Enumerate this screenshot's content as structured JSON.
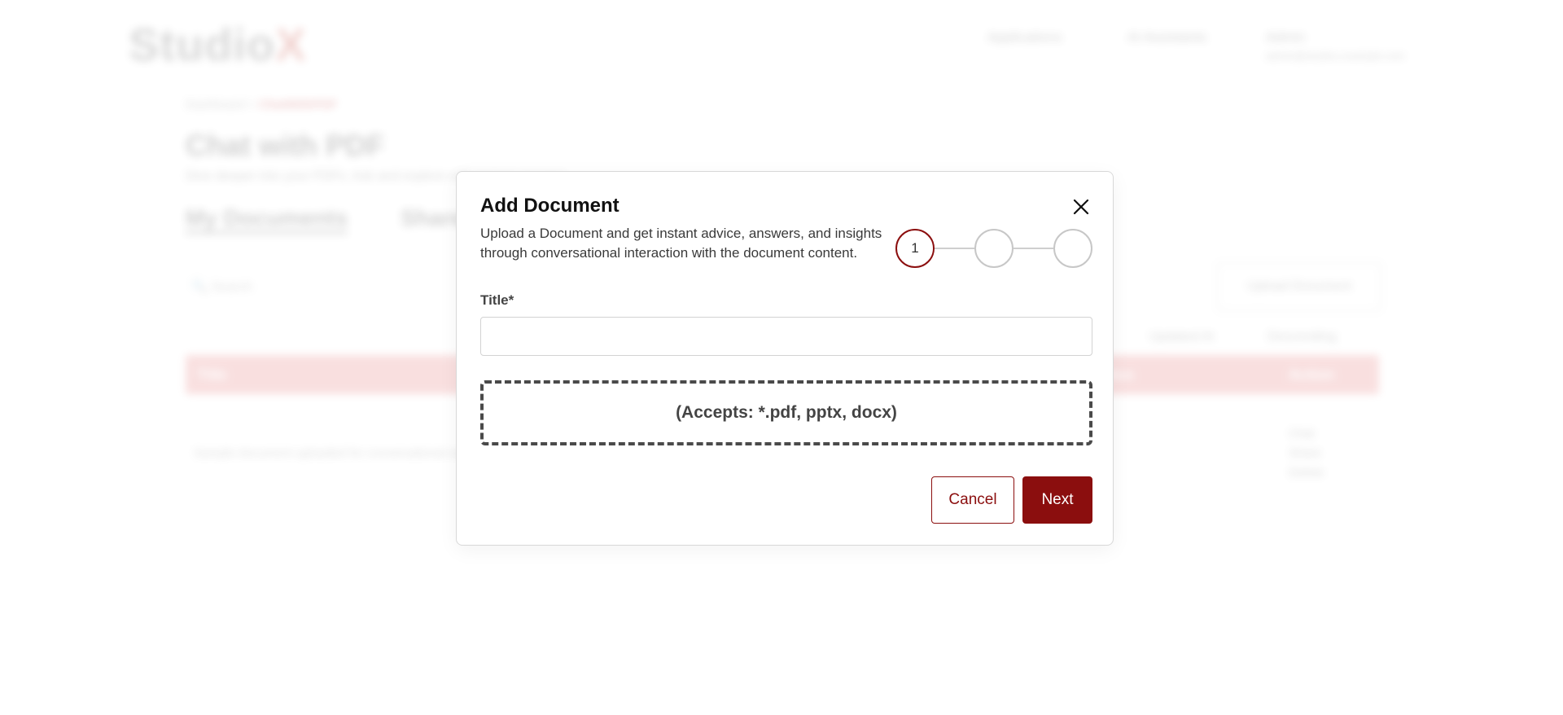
{
  "background": {
    "logo_main": "Studio",
    "logo_accent": "X",
    "nav": [
      "Applications",
      "AI Assistants",
      "Admin"
    ],
    "admin_email": "admin@studiox.example.com",
    "breadcrumb": {
      "parent": "Dashboard",
      "separator": ">",
      "current": "ChatWithPDF"
    },
    "page_title": "Chat with PDF",
    "page_subtitle": "Dive deeper into your PDFs. Ask and explore with instant answers.",
    "tabs": [
      "My Documents",
      "Shared"
    ],
    "search_placeholder": "Search",
    "upload_button": "Upload Document",
    "sort_by": "Updated At",
    "sort_order": "Descending",
    "table_headers": {
      "title": "Title",
      "status": "Status",
      "action": "Action"
    },
    "row_text": "Sample document uploaded for conversational analysis",
    "row_actions": [
      "Chat",
      "Share",
      "Delete"
    ]
  },
  "modal": {
    "title": "Add Document",
    "description": "Upload a Document and get instant advice, answers, and insights through conversational interaction with the document content.",
    "steps": [
      "1",
      "",
      ""
    ],
    "active_step": 1,
    "title_label": "Title*",
    "title_value": "",
    "title_placeholder": "",
    "dropzone_text": "(Accepts: *.pdf, pptx, docx)",
    "cancel_label": "Cancel",
    "next_label": "Next"
  },
  "colors": {
    "primary": "#8b0e0e",
    "step_inactive": "#c7c7c7",
    "dropzone_border": "#4a4a4a"
  },
  "icons": {
    "close": "close-icon"
  }
}
